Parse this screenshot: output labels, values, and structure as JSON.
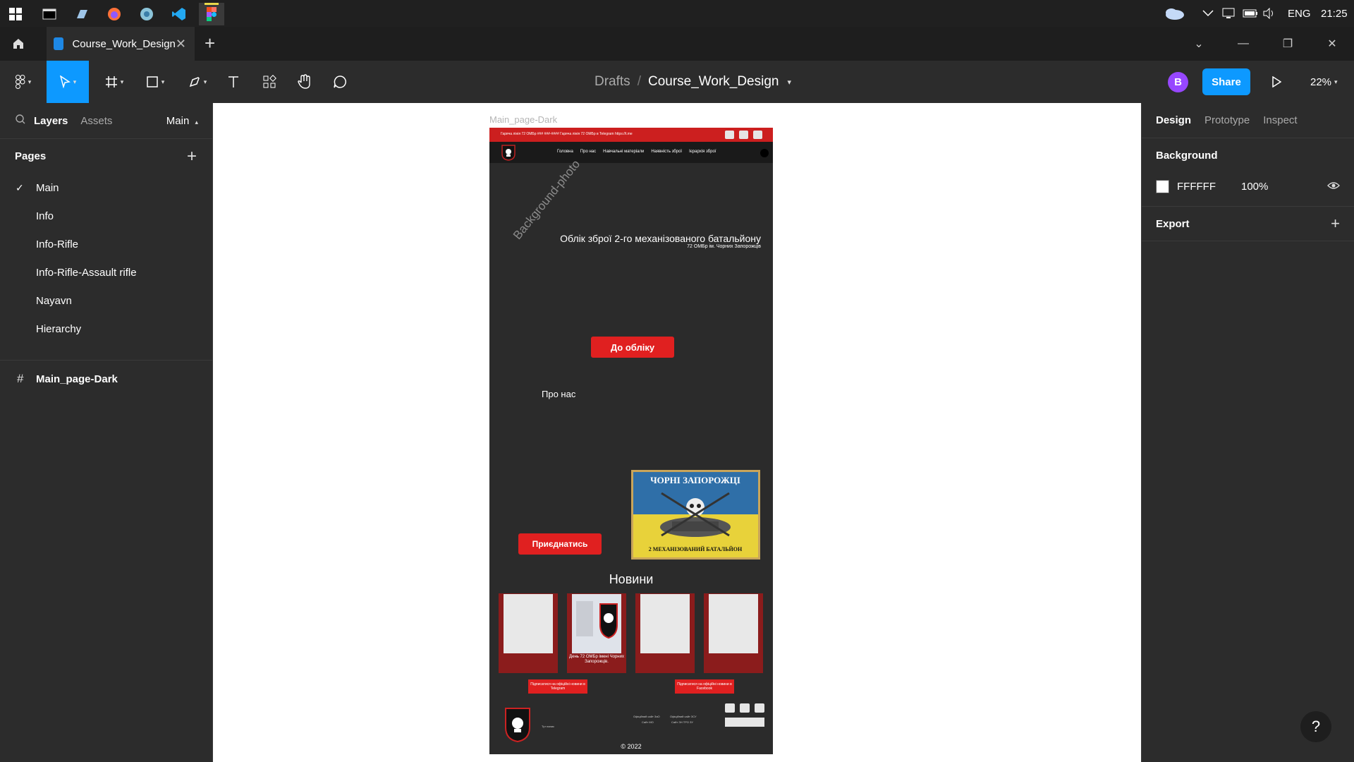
{
  "taskbar": {
    "apps": [
      {
        "name": "terminal-icon"
      },
      {
        "name": "file-explorer-icon"
      },
      {
        "name": "firefox-icon"
      },
      {
        "name": "chromium-icon"
      },
      {
        "name": "vscode-icon"
      },
      {
        "name": "figma-icon"
      }
    ],
    "language": "ENG",
    "time": "21:25"
  },
  "tabbar": {
    "file_tab_label": "Course_Work_Design",
    "new_tab": "+"
  },
  "toolbar": {
    "breadcrumb_drafts": "Drafts",
    "breadcrumb_sep": "/",
    "file_name": "Course_Work_Design",
    "avatar_initial": "B",
    "share_label": "Share",
    "zoom_label": "22%"
  },
  "left_panel": {
    "tabs": [
      "Layers",
      "Assets"
    ],
    "page_selector": "Main",
    "pages_title": "Pages",
    "pages": [
      "Main",
      "Info",
      "Info-Rifle",
      "Info-Rifle-Assault rifle",
      "Nayavn",
      "Hierarchy"
    ],
    "selected_page": "Main",
    "layers": [
      "Main_page-Dark"
    ]
  },
  "canvas": {
    "frame_label": "Main_page-Dark",
    "frame": {
      "topbar_text": "Гаряча лінія 72 ОМБр    ### ###-####    Гаряча лінія 72 ОМБр в Telegram    https://t.me",
      "nav_links": [
        "Головна",
        "Про нас",
        "Навчальні матеріали",
        "Наявність зброї",
        "Ієрархія зброї"
      ],
      "bg_photo_label": "Background-photo",
      "hero_title": "Облік зброї 2-го механізованого батальйону",
      "hero_subtitle": "72 ОМБр ім. Чорних Запорожців",
      "cta_button": "До обліку",
      "about_label": "Про нас",
      "join_button": "Приєднатись",
      "flag_top_text": "ЧОРНІ ЗАПОРОЖЦІ",
      "flag_bottom_text": "2 МЕХАНІЗОВАНИЙ БАТАЛЬЙОН",
      "news_title": "Новини",
      "news_card_caption": "День 72 ОМБр імені Чорних Запорожців.",
      "subscribe_telegram": "Підписатися на офіційні новини в Telegram",
      "subscribe_facebook": "Підписатися на офіційні новини в Facebook",
      "footer_text_left": "Тут напис",
      "footer_links": [
        "Офіційний сайт ЗаО",
        "Сайт МО",
        "Офіційний сайт ЗСУ",
        "Сайт ЗН ТРО ЗУ"
      ],
      "copyright": "© 2022"
    }
  },
  "right_panel": {
    "tabs": [
      "Design",
      "Prototype",
      "Inspect"
    ],
    "background_title": "Background",
    "background_hex": "FFFFFF",
    "background_opacity": "100%",
    "export_title": "Export"
  },
  "colors": {
    "accent": "#0d99ff",
    "brand_red": "#e02020",
    "frame_bg": "#2b2b2b"
  }
}
